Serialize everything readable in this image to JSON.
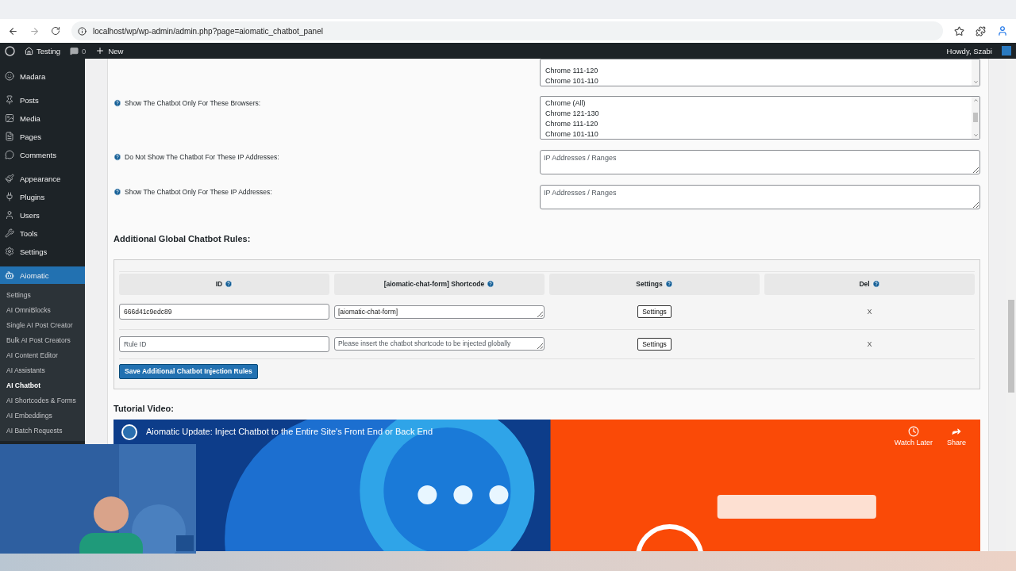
{
  "browser": {
    "url": "localhost/wp/wp-admin/admin.php?page=aiomatic_chatbot_panel"
  },
  "admin_bar": {
    "site": "Testing",
    "comments": "0",
    "new": "New",
    "greeting": "Howdy, Szabi"
  },
  "sidebar": {
    "groups": [
      [
        {
          "label": "Madara",
          "selected": false
        }
      ],
      [
        {
          "label": "Posts",
          "selected": false
        },
        {
          "label": "Media",
          "selected": false
        },
        {
          "label": "Pages",
          "selected": false
        },
        {
          "label": "Comments",
          "selected": false
        }
      ],
      [
        {
          "label": "Appearance",
          "selected": false
        },
        {
          "label": "Plugins",
          "selected": false
        },
        {
          "label": "Users",
          "selected": false
        },
        {
          "label": "Tools",
          "selected": false
        },
        {
          "label": "Settings",
          "selected": false
        }
      ],
      [
        {
          "label": "Aiomatic",
          "selected": true
        }
      ]
    ],
    "submenu": [
      {
        "label": "Settings",
        "selected": false
      },
      {
        "label": "AI OmniBlocks",
        "selected": false
      },
      {
        "label": "Single AI Post Creator",
        "selected": false
      },
      {
        "label": "Bulk AI Post Creators",
        "selected": false
      },
      {
        "label": "AI Content Editor",
        "selected": false
      },
      {
        "label": "AI Assistants",
        "selected": false
      },
      {
        "label": "AI Chatbot",
        "selected": true
      },
      {
        "label": "AI Shortcodes & Forms",
        "selected": false
      },
      {
        "label": "AI Embeddings",
        "selected": false
      },
      {
        "label": "AI Batch Requests",
        "selected": false
      }
    ]
  },
  "form_rows": [
    {
      "kind": "listbox",
      "options": [
        "Chrome 111-120",
        "Chrome 101-110"
      ]
    },
    {
      "kind": "listbox",
      "label": "Show The Chatbot Only For These Browsers:",
      "options": [
        "Chrome (All)",
        "Chrome 121-130",
        "Chrome 111-120",
        "Chrome 101-110"
      ]
    },
    {
      "kind": "textarea",
      "label": "Do Not Show The Chatbot For These IP Addresses:",
      "placeholder": "IP Addresses / Ranges"
    },
    {
      "kind": "textarea",
      "label": "Show The Chatbot Only For These IP Addresses:",
      "placeholder": "IP Addresses / Ranges"
    }
  ],
  "rules": {
    "heading": "Additional Global Chatbot Rules:",
    "columns": [
      "ID",
      "[aiomatic-chat-form] Shortcode",
      "Settings",
      "Del"
    ],
    "rows": [
      {
        "id": {
          "value": "666d41c9edc89"
        },
        "shortcode": {
          "value": "[aiomatic-chat-form]"
        },
        "settings": "Settings",
        "delete": "X"
      },
      {
        "id": {
          "placeholder": "Rule ID"
        },
        "shortcode": {
          "placeholder": "Please insert the chatbot shortcode to be injected globally"
        },
        "settings": "Settings",
        "delete": "X"
      }
    ],
    "save_button": "Save Additional Chatbot Injection Rules"
  },
  "tutorial": {
    "heading": "Tutorial Video:",
    "video": {
      "kind": "picture",
      "title": "Aiomatic Update: Inject Chatbot to the Entire Site's Front End or Back End",
      "actions": [
        "Watch Later",
        "Share"
      ]
    }
  }
}
